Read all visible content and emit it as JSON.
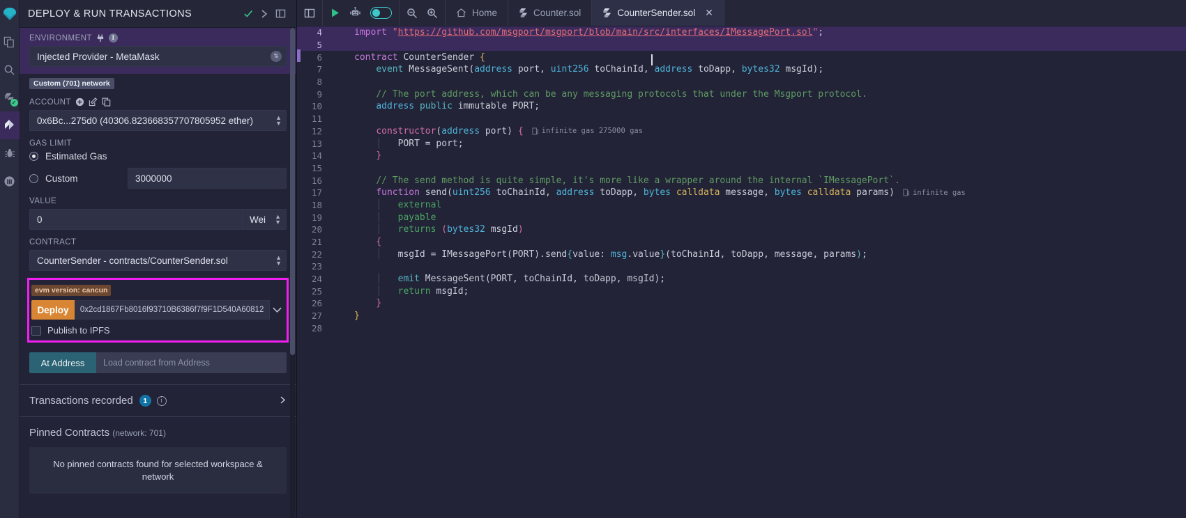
{
  "iconbar": {
    "items": [
      {
        "name": "remix-logo",
        "label": "Remix"
      },
      {
        "name": "file-explorer",
        "label": "File explorer"
      },
      {
        "name": "search",
        "label": "Search in files"
      },
      {
        "name": "solidity-compiler",
        "label": "Solidity compiler"
      },
      {
        "name": "deploy-run",
        "label": "Deploy & run transactions"
      },
      {
        "name": "debugger",
        "label": "Debugger"
      },
      {
        "name": "analysis",
        "label": "Solidity analyzers"
      }
    ]
  },
  "panel": {
    "title": "DEPLOY & RUN TRANSACTIONS",
    "environment": {
      "label": "ENVIRONMENT",
      "value": "Injected Provider - MetaMask",
      "network_tag": "Custom (701) network"
    },
    "account": {
      "label": "ACCOUNT",
      "value": "0x6Bc...275d0 (40306.823668357707805952 ether)"
    },
    "gas_limit": {
      "label": "GAS LIMIT",
      "estimated_label": "Estimated Gas",
      "custom_label": "Custom",
      "custom_value": "3000000",
      "selected": "estimated"
    },
    "value": {
      "label": "VALUE",
      "amount": "0",
      "unit": "Wei"
    },
    "contract": {
      "label": "CONTRACT",
      "value": "CounterSender - contracts/CounterSender.sol"
    },
    "deploy": {
      "evm_version_tag": "evm version: cancun",
      "button_label": "Deploy",
      "constructor_arg": "0x2cd1867Fb8016f93710B6386f7f9F1D540A60812",
      "publish_ipfs_label": "Publish to IPFS",
      "publish_ipfs_checked": false,
      "highlight_color": "#f11ff1"
    },
    "at_address": {
      "button_label": "At Address",
      "placeholder": "Load contract from Address"
    },
    "transactions": {
      "title": "Transactions recorded",
      "count": "1"
    },
    "pinned": {
      "title": "Pinned Contracts",
      "subtitle": "(network: 701)",
      "empty_message": "No pinned contracts found for selected workspace & network"
    }
  },
  "toolbar": {
    "run_label": "run",
    "robot_label": "remix-ai",
    "toggle_label": "ai-toggle",
    "zoom_out_label": "zoom-out",
    "zoom_in_label": "zoom-in"
  },
  "tabs": [
    {
      "label": "Home",
      "icon": "home-icon",
      "active": false,
      "closable": false
    },
    {
      "label": "Counter.sol",
      "icon": "solidity-icon",
      "active": false,
      "closable": false
    },
    {
      "label": "CounterSender.sol",
      "icon": "solidity-icon",
      "active": true,
      "closable": true
    }
  ],
  "editor": {
    "lines": [
      {
        "n": "4",
        "highlight": true,
        "html": "<span class=\"k1\">import</span> <span class=\"str\">\"<u>https://github.com/msgport/msgport/blob/main/src/interfaces/IMessagePort.sol</u>\"</span><span class=\"wt\">;</span>"
      },
      {
        "n": "5",
        "highlight": true,
        "html": ""
      },
      {
        "n": "6",
        "highlight": false,
        "html": "<span class=\"k1\">contract</span> <span class=\"wt\">CounterSender</span> <span class=\"yl\">{</span>"
      },
      {
        "n": "7",
        "highlight": false,
        "html": "    <span class=\"k3\">event</span> <span class=\"wt\">MessageSent(</span><span class=\"k2\">address</span><span class=\"wt\"> port, </span><span class=\"k2\">uint256</span><span class=\"wt\"> toChainId, </span><span class=\"k2\">address</span><span class=\"wt\"> toDapp, </span><span class=\"k2\">bytes32</span><span class=\"wt\"> msgId);</span>"
      },
      {
        "n": "8",
        "highlight": false,
        "html": ""
      },
      {
        "n": "9",
        "highlight": false,
        "html": "    <span class=\"cmt\">// The port address, which can be any messaging protocols that under the Msgport protocol.</span>"
      },
      {
        "n": "10",
        "highlight": false,
        "html": "    <span class=\"k2\">address</span> <span class=\"k3\">public</span> <span class=\"wt\">immutable PORT;</span>"
      },
      {
        "n": "11",
        "highlight": false,
        "html": ""
      },
      {
        "n": "12",
        "highlight": false,
        "html": "    <span class=\"pk\">constructor</span><span class=\"wt\">(</span><span class=\"k2\">address</span><span class=\"wt\"> port) </span><span class=\"pk\">{</span>",
        "gas": "infinite gas 275000 gas"
      },
      {
        "n": "13",
        "highlight": false,
        "html": "    <span class=\"indent-guide\">│</span>   <span class=\"wt\">PORT = port;</span>"
      },
      {
        "n": "14",
        "highlight": false,
        "html": "    <span class=\"pk\">}</span>"
      },
      {
        "n": "15",
        "highlight": false,
        "html": ""
      },
      {
        "n": "16",
        "highlight": false,
        "html": "    <span class=\"cmt\">// The send method is quite simple, it's more like a wrapper around the internal `IMessagePort`.</span>"
      },
      {
        "n": "17",
        "highlight": false,
        "html": "    <span class=\"k1\">function</span> <span class=\"wt\">send(</span><span class=\"k2\">uint256</span><span class=\"wt\"> toChainId, </span><span class=\"k2\">address</span><span class=\"wt\"> toDapp, </span><span class=\"k2\">bytes</span> <span class=\"yl\">calldata</span><span class=\"wt\"> message, </span><span class=\"k2\">bytes</span> <span class=\"yl\">calldata</span><span class=\"wt\"> params)</span>",
        "gas": "infinite gas"
      },
      {
        "n": "18",
        "highlight": false,
        "html": "    <span class=\"indent-guide\">│</span>   <span class=\"gr\">external</span>"
      },
      {
        "n": "19",
        "highlight": false,
        "html": "    <span class=\"indent-guide\">│</span>   <span class=\"gr\">payable</span>"
      },
      {
        "n": "20",
        "highlight": false,
        "html": "    <span class=\"indent-guide\">│</span>   <span class=\"gr\">returns</span> <span class=\"pk\">(</span><span class=\"k2\">bytes32</span><span class=\"wt\"> msgId</span><span class=\"pk\">)</span>"
      },
      {
        "n": "21",
        "highlight": false,
        "html": "    <span class=\"pk\">{</span>"
      },
      {
        "n": "22",
        "highlight": false,
        "html": "    <span class=\"indent-guide\">│</span>   <span class=\"wt\">msgId = IMessagePort(PORT).send</span><span class=\"k3\">{</span><span class=\"wt\">value: </span><span class=\"k2\">msg</span><span class=\"wt\">.value</span><span class=\"k3\">}</span><span class=\"wt\">(toChainId, toDapp, message, params</span><span class=\"k3\">)</span><span class=\"wt\">;</span>"
      },
      {
        "n": "23",
        "highlight": false,
        "html": ""
      },
      {
        "n": "24",
        "highlight": false,
        "html": "    <span class=\"indent-guide\">│</span>   <span class=\"k3\">emit</span> <span class=\"wt\">MessageSent(PORT, toChainId, toDapp, msgId);</span>"
      },
      {
        "n": "25",
        "highlight": false,
        "html": "    <span class=\"indent-guide\">│</span>   <span class=\"gr\">return</span> <span class=\"wt\">msgId;</span>"
      },
      {
        "n": "26",
        "highlight": false,
        "html": "    <span class=\"pk\">}</span>"
      },
      {
        "n": "27",
        "highlight": false,
        "html": "<span class=\"yl\">}</span>"
      },
      {
        "n": "28",
        "highlight": false,
        "html": ""
      }
    ]
  }
}
